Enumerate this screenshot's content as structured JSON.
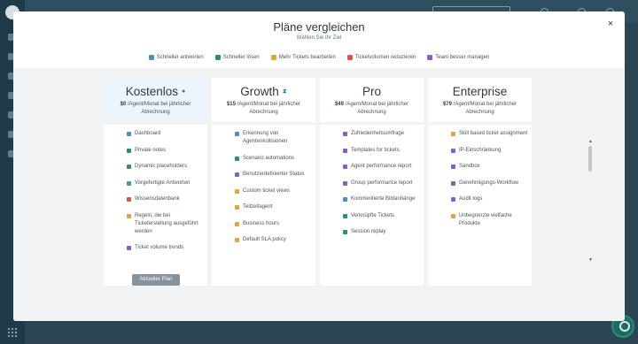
{
  "modal": {
    "title": "Pläne vergleichen",
    "subtitle": "Wählen Sie Ihr Ziel",
    "close_label": "×"
  },
  "filters": [
    {
      "label": "Schneller antworten",
      "icon": "reply-icon",
      "color": "#4a90b8"
    },
    {
      "label": "Schneller lösen",
      "icon": "check-icon",
      "color": "#2f8f74"
    },
    {
      "label": "Mehr Tickets bearbeiten",
      "icon": "tickets-icon",
      "color": "#e9a13b"
    },
    {
      "label": "Ticketvolumen reduzieren",
      "icon": "volume-icon",
      "color": "#d9534f"
    },
    {
      "label": "Team besser managen",
      "icon": "team-icon",
      "color": "#8a5bd0"
    }
  ],
  "plans": [
    {
      "name": "Kostenlos",
      "badge": "●",
      "price": "$0",
      "price_note": "/Agent/Monat bei jährlicher Abrechnung",
      "current": true,
      "features": [
        {
          "label": "Dashboard",
          "color": "#4a90b8"
        },
        {
          "label": "Private notes",
          "color": "#2f8f74"
        },
        {
          "label": "Dynamic placeholders",
          "color": "#2f8f74"
        },
        {
          "label": "Vorgefertigte Antworten",
          "color": "#4a90b8"
        },
        {
          "label": "Wissensdatenbank",
          "color": "#d9534f"
        },
        {
          "label": "Regeln, die bei Ticketerstellung ausgeführt werden",
          "color": "#e9a13b"
        },
        {
          "label": "Ticket volume trends",
          "color": "#8a5bd0"
        }
      ],
      "button": "Aktueller Plan"
    },
    {
      "name": "Growth",
      "badge": "⧗",
      "price": "$15",
      "price_note": "/Agent/Monat bei jährlicher Abrechnung",
      "features": [
        {
          "label": "Erkennung von Agentenkollisionen",
          "color": "#4a90b8"
        },
        {
          "label": "Scenario automations",
          "color": "#2f8f74"
        },
        {
          "label": "Benutzerdefinierter Status",
          "color": "#8a5bd0"
        },
        {
          "label": "Custom ticket views",
          "color": "#e9a13b"
        },
        {
          "label": "Teilzeitagent",
          "color": "#e9a13b"
        },
        {
          "label": "Business hours",
          "color": "#e9a13b"
        },
        {
          "label": "Default SLA policy",
          "color": "#e9a13b"
        }
      ]
    },
    {
      "name": "Pro",
      "badge": "",
      "price": "$49",
      "price_note": "/Agent/Monat bei jährlicher Abrechnung",
      "features": [
        {
          "label": "Zufriedenheitsumfrage",
          "color": "#8a5bd0"
        },
        {
          "label": "Templates for tickets",
          "color": "#8a5bd0"
        },
        {
          "label": "Agent performance report",
          "color": "#8a5bd0"
        },
        {
          "label": "Group performance report",
          "color": "#8a5bd0"
        },
        {
          "label": "Kommentierte Bildanhänge",
          "color": "#4a90b8"
        },
        {
          "label": "Verknüpfte Tickets",
          "color": "#2f8f74"
        },
        {
          "label": "Session replay",
          "color": "#2f8f74"
        }
      ]
    },
    {
      "name": "Enterprise",
      "badge": "",
      "price": "$79",
      "price_note": "/Agent/Monat bei jährlicher Abrechnung",
      "features": [
        {
          "label": "Skill based ticket assignment",
          "color": "#e9a13b"
        },
        {
          "label": "IP-Einschränkung",
          "color": "#8a5bd0"
        },
        {
          "label": "Sandbox",
          "color": "#8a5bd0"
        },
        {
          "label": "Genehmigungs-Workflow",
          "color": "#8a5bd0"
        },
        {
          "label": "Audit logs",
          "color": "#8a5bd0"
        },
        {
          "label": "Unbegrenzte vielfache Produkte",
          "color": "#e9a13b"
        }
      ]
    }
  ]
}
